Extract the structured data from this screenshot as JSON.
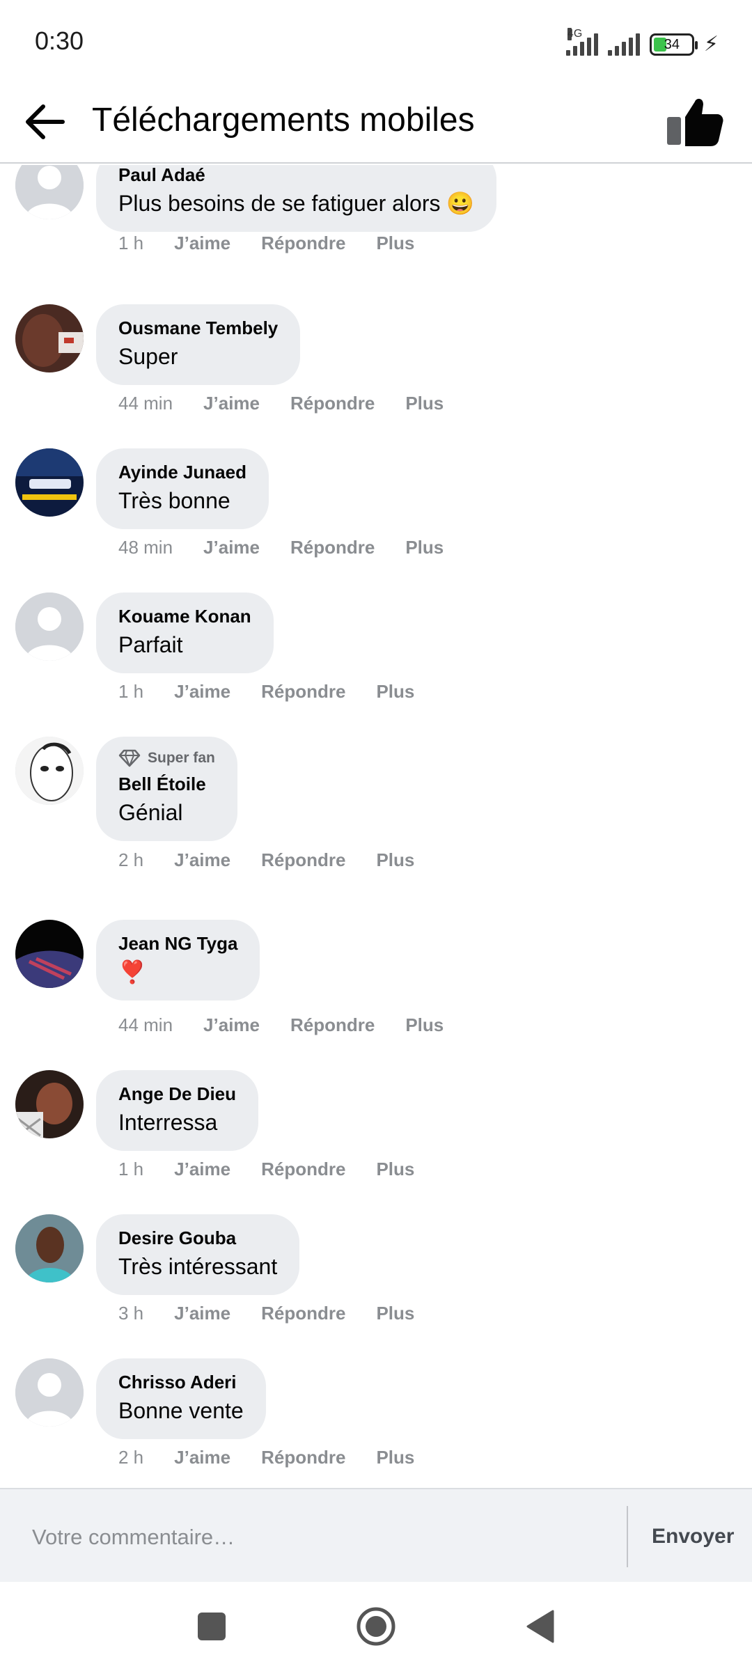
{
  "status_bar": {
    "time": "0:30",
    "network": "4G",
    "battery": "34",
    "battery_level": 0.34
  },
  "header": {
    "title": "Téléchargements mobiles",
    "back_icon": "arrow-left-icon",
    "like_icon": "thumbs-up-icon"
  },
  "actions": {
    "like": "J’aime",
    "reply": "Répondre",
    "more": "Plus"
  },
  "comments": [
    {
      "author": "Paul Adaé",
      "text": "Plus besoins de se fatiguer alors 😀",
      "time": "1 h",
      "avatar": "default-avatar"
    },
    {
      "author": "Ousmane Tembely",
      "text": "Super",
      "time": "44 min",
      "avatar": "photo-avatar"
    },
    {
      "author": "Ayinde Junaed",
      "text": "Très bonne",
      "time": "48 min",
      "avatar": "photo-avatar"
    },
    {
      "author": "Kouame Konan",
      "text": "Parfait",
      "time": "1 h",
      "avatar": "default-avatar"
    },
    {
      "author": "Bell Étoile",
      "badge": "Super fan",
      "text": "Génial",
      "time": "2 h",
      "avatar": "photo-avatar"
    },
    {
      "author": "Jean NG Tyga",
      "text": "❣️",
      "time": "44 min",
      "avatar": "photo-avatar"
    },
    {
      "author": "Ange De Dieu",
      "text": "Interressa",
      "time": "1 h",
      "avatar": "photo-avatar"
    },
    {
      "author": "Desire Gouba",
      "text": "Très intéressant",
      "time": "3 h",
      "avatar": "photo-avatar"
    },
    {
      "author": "Chrisso Aderi",
      "text": "Bonne vente",
      "time": "2 h",
      "avatar": "default-avatar"
    }
  ],
  "composer": {
    "placeholder": "Votre commentaire…",
    "value": "",
    "send_label": "Envoyer"
  },
  "colors": {
    "bubble": "#ebedf0",
    "meta_text": "#8a8d91",
    "composer_bg": "#f0f2f5",
    "battery_fill": "#3cc34c"
  }
}
